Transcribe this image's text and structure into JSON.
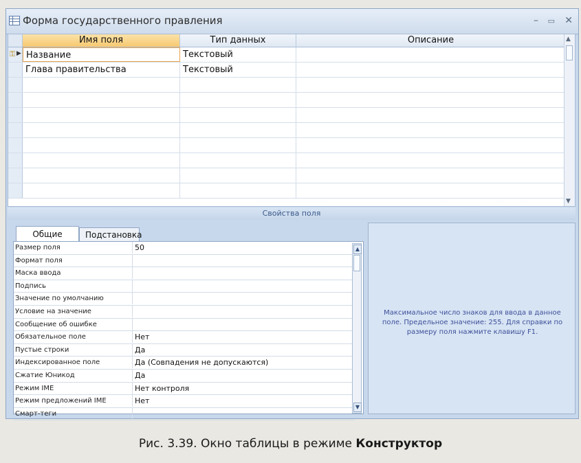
{
  "window": {
    "title": "Форма государственного правления"
  },
  "grid": {
    "headers": {
      "name": "Имя поля",
      "type": "Тип данных",
      "description": "Описание"
    },
    "rows": [
      {
        "name": "Название",
        "type": "Текстовый",
        "description": ""
      },
      {
        "name": "Глава правительства",
        "type": "Текстовый",
        "description": ""
      }
    ]
  },
  "properties": {
    "title": "Свойства поля",
    "tabs": [
      "Общие",
      "Подстановка"
    ],
    "items": [
      {
        "label": "Размер поля",
        "value": "50"
      },
      {
        "label": "Формат поля",
        "value": ""
      },
      {
        "label": "Маска ввода",
        "value": ""
      },
      {
        "label": "Подпись",
        "value": ""
      },
      {
        "label": "Значение по умолчанию",
        "value": ""
      },
      {
        "label": "Условие на значение",
        "value": ""
      },
      {
        "label": "Сообщение об ошибке",
        "value": ""
      },
      {
        "label": "Обязательное поле",
        "value": "Нет"
      },
      {
        "label": "Пустые строки",
        "value": "Да"
      },
      {
        "label": "Индексированное поле",
        "value": "Да (Совпадения не допускаются)"
      },
      {
        "label": "Сжатие Юникод",
        "value": "Да"
      },
      {
        "label": "Режим IME",
        "value": "Нет контроля"
      },
      {
        "label": "Режим предложений IME",
        "value": "Нет"
      },
      {
        "label": "Смарт-теги",
        "value": ""
      }
    ],
    "help": "Максимальное число знаков для ввода в данное поле. Предельное значение: 255. Для справки по размеру поля нажмите клавишу F1."
  },
  "caption": {
    "prefix": "Рис. 3.39. Окно таблицы в режиме ",
    "bold": "Конструктор"
  }
}
